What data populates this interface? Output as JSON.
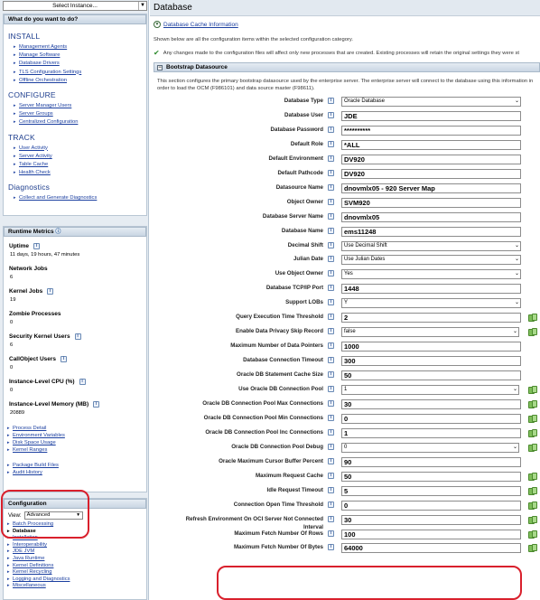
{
  "instance_select": {
    "label": "Select Instance..."
  },
  "todo": {
    "header": "What do you want to do?",
    "sections": [
      {
        "title": "INSTALL",
        "items": [
          "Management Agents",
          "Manage Software",
          "Database Drivers",
          "TLS Configuration Settings",
          "Offline Orchestration"
        ]
      },
      {
        "title": "CONFIGURE",
        "items": [
          "Server Manager Users",
          "Server Groups",
          "Centralized Configuration"
        ]
      },
      {
        "title": "TRACK",
        "items": [
          "User Activity",
          "Server Activity",
          "Table Cache",
          "Health Check"
        ]
      },
      {
        "title": "Diagnostics",
        "items": [
          "Collect and Generate Diagnostics"
        ]
      }
    ]
  },
  "metrics": {
    "header": "Runtime Metrics",
    "uptime_label": "Uptime",
    "uptime_value": "11 days, 19 hours, 47 minutes",
    "items": [
      {
        "label": "Network Jobs",
        "value": "6"
      },
      {
        "label": "Kernel Jobs",
        "value": "19"
      },
      {
        "label": "Zombie Processes",
        "value": "0"
      },
      {
        "label": "Security Kernel Users",
        "value": "6"
      },
      {
        "label": "CallObject Users",
        "value": "0"
      },
      {
        "label": "Instance-Level CPU (%)",
        "value": "0"
      },
      {
        "label": "Instance-Level Memory (MB)",
        "value": "20889"
      }
    ],
    "links_a": [
      "Process Detail",
      "Environment Variables",
      "Disk Space Usage",
      "Kernel Ranges"
    ],
    "links_b": [
      "Package Build Files",
      "Audit History"
    ]
  },
  "config": {
    "header": "Configuration",
    "view_label": "View:",
    "view_value": "Advanced",
    "items": [
      "Batch Processing",
      "Database",
      "Installation",
      "Interoperability",
      "JDE JVM",
      "Java Runtime",
      "Kernel Definitions",
      "Kernel Recycling",
      "Logging and Diagnostics",
      "Miscellaneous"
    ]
  },
  "page": {
    "title": "Database",
    "cache_link": "Database Cache Information",
    "intro": "Shown below are all the configuration items within the selected configuration category.",
    "notice": "Any changes made to the configuration files will affect only new processes that are created. Existing processes will retain the original settings they were st",
    "section_title": "Bootstrap Datasource",
    "section_desc": "This section configures the primary bootstrap datasource used by the enterprise server. The enterprise server will connect to the database using this information in order to load the OCM (F986101) and data source master (F98611).",
    "fields": [
      {
        "label": "Database Type",
        "value": "Oracle Database",
        "kind": "select"
      },
      {
        "label": "Database User",
        "value": "JDE",
        "kind": "text"
      },
      {
        "label": "Database Password",
        "value": "**********",
        "kind": "text"
      },
      {
        "label": "Default Role",
        "value": "*ALL",
        "kind": "text"
      },
      {
        "label": "Default Environment",
        "value": "DV920",
        "kind": "text"
      },
      {
        "label": "Default Pathcode",
        "value": "DV920",
        "kind": "text"
      },
      {
        "label": "Datasource Name",
        "value": "dnovmlx05 - 920 Server Map",
        "kind": "text"
      },
      {
        "label": "Object Owner",
        "value": "SVM920",
        "kind": "text"
      },
      {
        "label": "Database Server Name",
        "value": "dnovmlx05",
        "kind": "text"
      },
      {
        "label": "Database Name",
        "value": "ems11248",
        "kind": "text"
      },
      {
        "label": "Decimal Shift",
        "value": "Use Decimal Shift",
        "kind": "select"
      },
      {
        "label": "Julian Date",
        "value": "Use Julian Dates",
        "kind": "select"
      },
      {
        "label": "Use Object Owner",
        "value": "Yes",
        "kind": "select"
      },
      {
        "label": "Database TCP/IP Port",
        "value": "1448",
        "kind": "text"
      },
      {
        "label": "Support LOBs",
        "value": "Y",
        "kind": "select"
      },
      {
        "label": "Query Execution Time Threshold",
        "value": "2",
        "kind": "text",
        "apply": true
      },
      {
        "label": "Enable Data Privacy Skip Record",
        "value": "false",
        "kind": "select",
        "apply": true
      },
      {
        "label": "Maximum Number of Data Pointers",
        "value": "1000",
        "kind": "text"
      },
      {
        "label": "Database Connection Timeout",
        "value": "300",
        "kind": "text"
      },
      {
        "label": "Oracle DB Statement Cache Size",
        "value": "50",
        "kind": "text"
      },
      {
        "label": "Use Oracle DB Connection Pool",
        "value": "1",
        "kind": "select",
        "apply": true
      },
      {
        "label": "Oracle DB Connection Pool Max Connections",
        "value": "30",
        "kind": "text",
        "apply": true
      },
      {
        "label": "Oracle DB Connection Pool Min Connections",
        "value": "0",
        "kind": "text",
        "apply": true
      },
      {
        "label": "Oracle DB Connection Pool Inc Connections",
        "value": "1",
        "kind": "text",
        "apply": true
      },
      {
        "label": "Oracle DB Connection Pool Debug",
        "value": "0",
        "kind": "select",
        "apply": true
      },
      {
        "label": "Oracle Maximum Cursor Buffer Percent",
        "value": "90",
        "kind": "text"
      },
      {
        "label": "Maximum Request Cache",
        "value": "50",
        "kind": "text",
        "apply": true
      },
      {
        "label": "Idle Request Timeout",
        "value": "5",
        "kind": "text",
        "apply": true
      },
      {
        "label": "Connection Open Time Threshold",
        "value": "0",
        "kind": "text",
        "apply": true
      },
      {
        "label": "Refresh Environment On OCI Server Not Connected Interval",
        "value": "30",
        "kind": "text",
        "apply": true
      },
      {
        "label": "Maximum Fetch Number Of Rows",
        "value": "100",
        "kind": "text",
        "apply": true
      },
      {
        "label": "Maximum Fetch Number Of Bytes",
        "value": "64000",
        "kind": "text",
        "apply": true
      }
    ]
  },
  "colors": {
    "link": "#1b3fa0",
    "annotation": "#d9202c",
    "panel_bg": "#e6ecf2"
  }
}
